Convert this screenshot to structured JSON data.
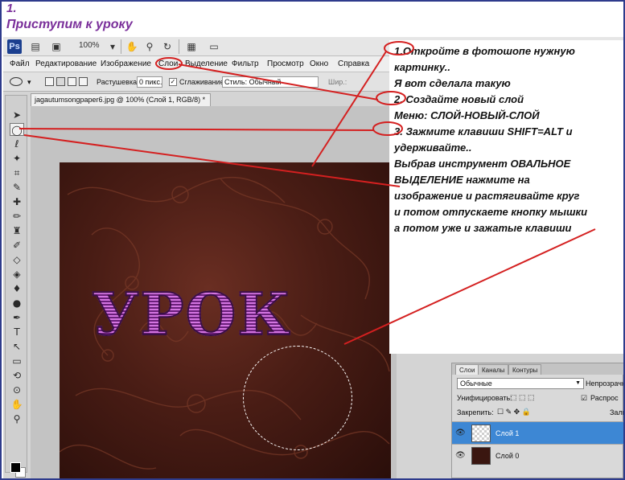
{
  "header": {
    "step": "1.",
    "title": "Приступим к уроку"
  },
  "app": {
    "logo": "Ps",
    "zoom": "100%",
    "menu": [
      "Файл",
      "Редактирование",
      "Изображение",
      "Слои",
      "Выделение",
      "Фильтр",
      "Просмотр",
      "Окно",
      "Справка"
    ],
    "options": {
      "feather_label": "Растушевка:",
      "feather_value": "0 пикс.",
      "antialias_label": "Сглаживание",
      "style_value": "Стиль: Обычный",
      "width_label": "Шир.:"
    },
    "document_tab": "jagautumsongpaper6.jpg @ 100% (Слой 1, RGB/8) *",
    "artwork_text": "УРОК"
  },
  "instructions": [
    "1.Откройте в фотошопе нужную",
    "картинку..",
    "Я вот сделала такую",
    "2. Создайте новый слой",
    "Меню: СЛОЙ-НОВЫЙ-СЛОЙ",
    "3. Зажмите клавиши SHIFT=ALT и",
    "удерживайте..",
    "Выбрав инструмент ОВАЛЬНОЕ",
    "ВЫДЕЛЕНИЕ нажмите на",
    "изображение и растягивайте круг",
    "и потом отпускаете кнопку мышки",
    "а потом уже и зажатые клавиши"
  ],
  "layers_panel": {
    "tabs": [
      "Слои",
      "Каналы",
      "Контуры"
    ],
    "blend_mode": "Обычные",
    "opacity_label": "Непрозрачн",
    "unify_label": "Унифицировать:",
    "propagate_label": "Распрос",
    "lock_label": "Закрепить:",
    "fill_label": "Зали",
    "layers": [
      {
        "name": "Слой 1",
        "selected": true
      },
      {
        "name": "Слой 0",
        "selected": false
      }
    ]
  },
  "colors": {
    "accent": "#7a2f9a",
    "annotation": "#d42020",
    "selection": "#3d87d4"
  }
}
